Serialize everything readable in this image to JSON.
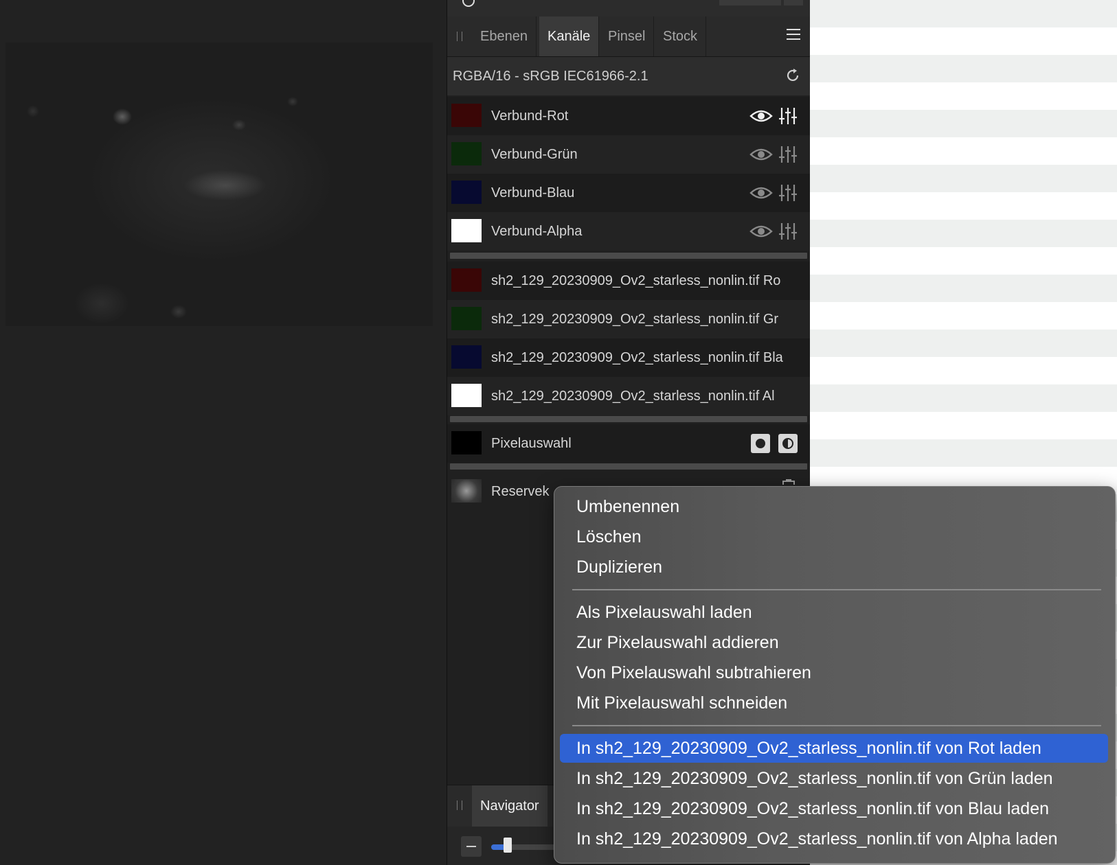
{
  "panel": {
    "tabs": [
      "Ebenen",
      "Kanäle",
      "Pinsel",
      "Stock"
    ],
    "active_tab": "Kanäle",
    "color_profile": "RGBA/16 - sRGB IEC61966-2.1"
  },
  "composite_channels": [
    {
      "label": "Verbund-Rot",
      "swatch": "#3a0606"
    },
    {
      "label": "Verbund-Grün",
      "swatch": "#0b2a0b"
    },
    {
      "label": "Verbund-Blau",
      "swatch": "#070a30"
    },
    {
      "label": "Verbund-Alpha",
      "swatch": "#ffffff"
    }
  ],
  "layer_channels": [
    {
      "label": "sh2_129_20230909_Ov2_starless_nonlin.tif Ro",
      "swatch": "#3a0606"
    },
    {
      "label": "sh2_129_20230909_Ov2_starless_nonlin.tif Gr",
      "swatch": "#0b2a0b"
    },
    {
      "label": "sh2_129_20230909_Ov2_starless_nonlin.tif Bla",
      "swatch": "#070a30"
    },
    {
      "label": "sh2_129_20230909_Ov2_starless_nonlin.tif Al",
      "swatch": "#ffffff"
    }
  ],
  "selection": {
    "label": "Pixelauswahl"
  },
  "spare": {
    "label": "Reservek"
  },
  "navigator": {
    "tab": "Navigator"
  },
  "context_menu": {
    "group1": [
      "Umbenennen",
      "Löschen",
      "Duplizieren"
    ],
    "group2": [
      "Als Pixelauswahl laden",
      "Zur Pixelauswahl addieren",
      "Von Pixelauswahl subtrahieren",
      "Mit Pixelauswahl schneiden"
    ],
    "group3": [
      "In sh2_129_20230909_Ov2_starless_nonlin.tif von Rot laden",
      "In sh2_129_20230909_Ov2_starless_nonlin.tif von Grün laden",
      "In sh2_129_20230909_Ov2_starless_nonlin.tif von Blau laden",
      "In sh2_129_20230909_Ov2_starless_nonlin.tif von Alpha laden"
    ],
    "highlighted": "In sh2_129_20230909_Ov2_starless_nonlin.tif von Rot laden"
  },
  "colors": {
    "highlight": "#2f62d3",
    "panel_bg": "#202020",
    "active_tab_bg": "#3a3a3a"
  }
}
